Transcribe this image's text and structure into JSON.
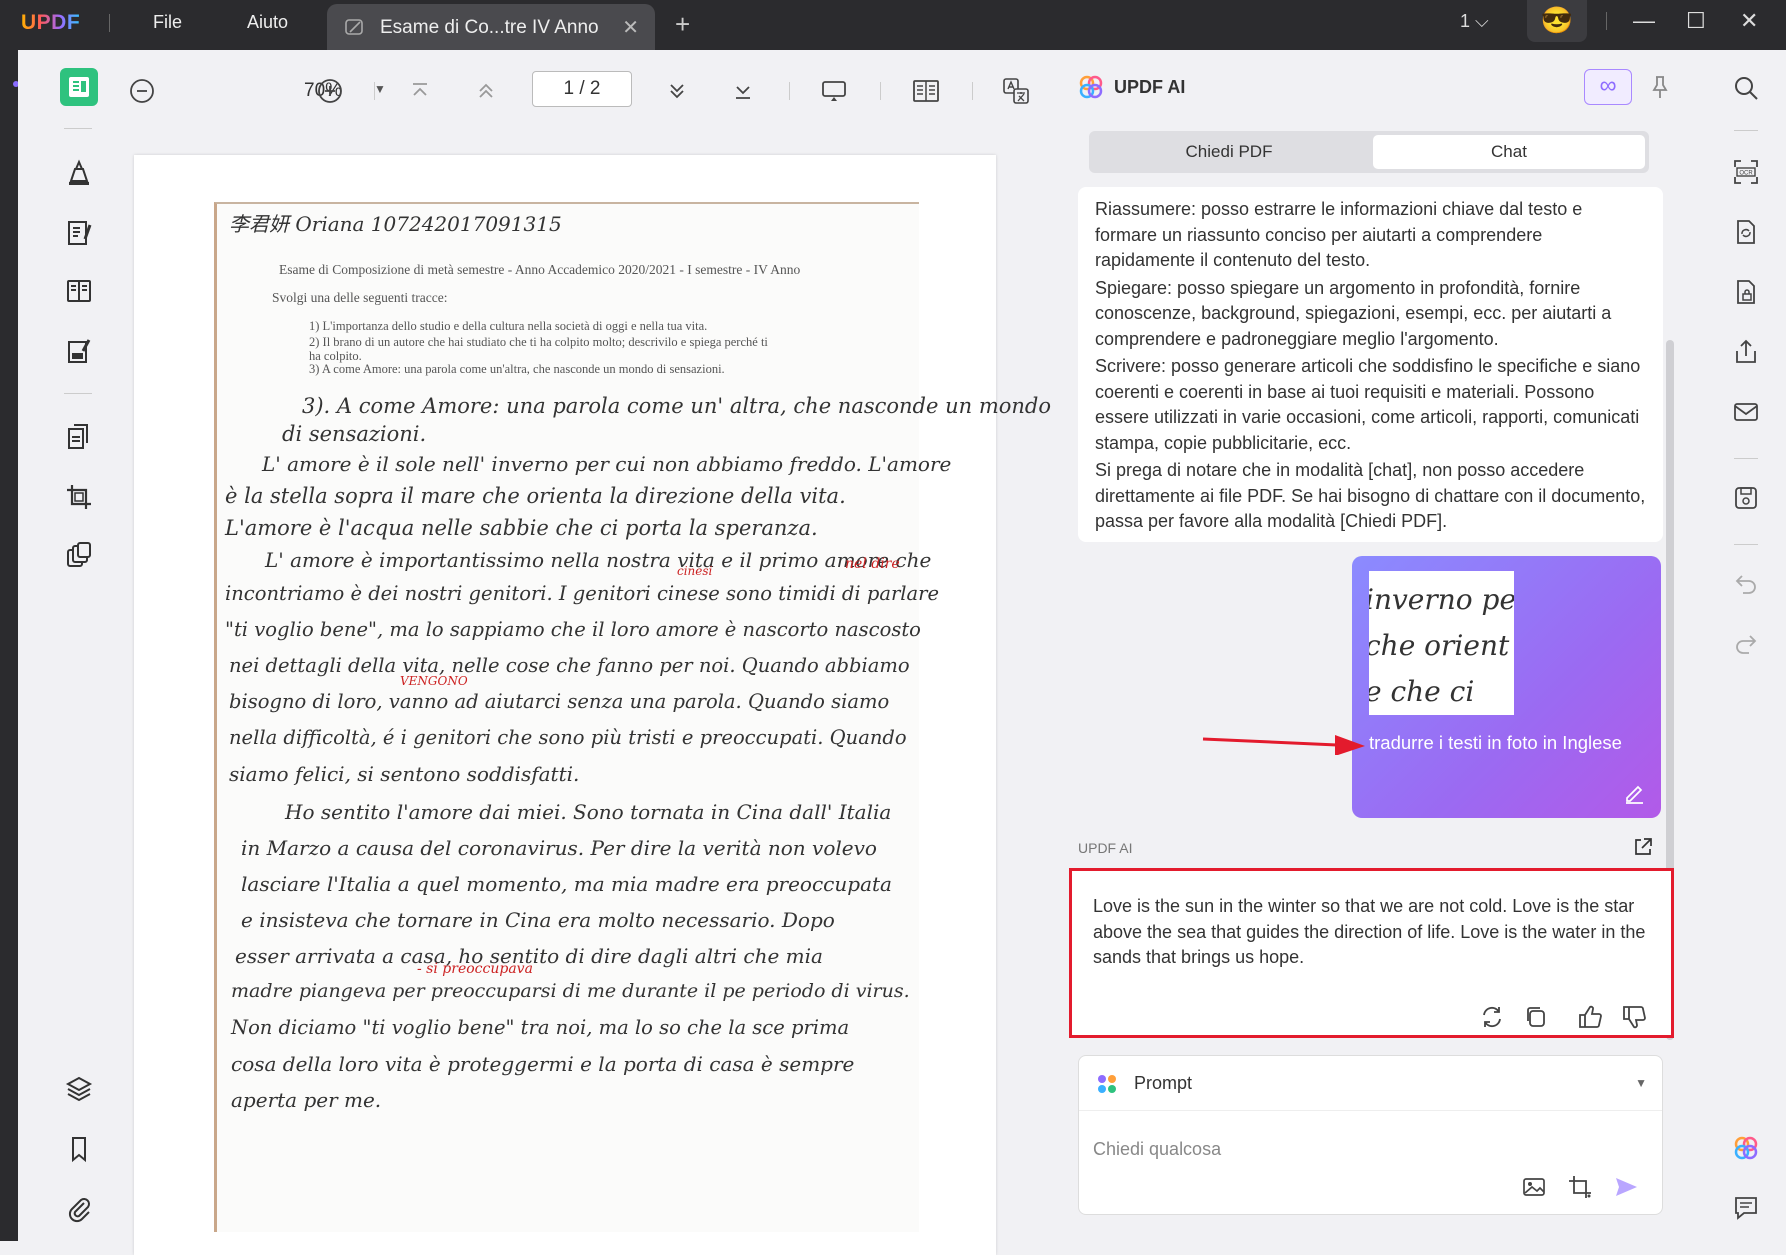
{
  "titlebar": {
    "logo": "UPDF",
    "menu_file": "File",
    "menu_help": "Aiuto",
    "tab_title": "Esame di Co...tre IV Anno",
    "tab_close": "✕",
    "add_tab": "+",
    "page_count": "1 ⌵",
    "avatar": "😎",
    "minimize": "—",
    "maximize": "☐",
    "close": "✕"
  },
  "toolbar": {
    "zoom": "70%",
    "zoom_dropdown": "▼",
    "page": "1 / 2"
  },
  "document": {
    "header_line": "李君妍   Oriana   107242017091315",
    "exam_title": "Esame di Composizione di metà semestre  -  Anno Accademico 2020/2021 - I semestre - IV Anno",
    "instruction": "Svolgi una delle seguenti tracce:",
    "traces": [
      "1)  L'importanza dello studio e della cultura nella società di oggi e nella tua vita.",
      "2)  Il brano di un autore che hai studiato che ti ha colpito molto; descrivilo e spiega perché ti",
      "     ha colpito.",
      "3)  A come Amore: una parola come un'altra, che nasconde un mondo di sensazioni."
    ],
    "handwriting": [
      "3). A come Amore: una parola come un' altra, che nasconde un mondo",
      "di sensazioni.",
      "L' amore è il sole nell' inverno per cui non abbiamo freddo. L'amore",
      "è la stella sopra il mare che orienta la direzione della vita.",
      "L'amore è l'acqua nelle sabbie che ci porta la speranza.",
      "L' amore è importantissimo nella nostra vita e il primo amore che",
      "incontriamo è dei nostri genitori. I genitori cinese sono timidi di parlare",
      "\"ti voglio bene\", ma lo sappiamo che il loro amore è nascorto nascosto",
      "nei dettagli della vita, nelle cose che fanno per noi. Quando abbiamo",
      "bisogno di loro, vanno ad aiutarci senza una parola. Quando siamo",
      "nella difficoltà, é i genitori che sono più tristi e preoccupati. Quando",
      "siamo felici, si sentono soddisfatti.",
      "Ho sentito l'amore dai miei. Sono tornata in Cina dall' Italia",
      "in Marzo a causa del coronavirus. Per dire la verità non volevo",
      "lasciare l'Italia a quel momento, ma mia madre era preoccupata",
      "e insisteva che tornare in Cina era molto necessario. Dopo",
      "esser arrivata a casa, ho sentito di dire dagli altri che mia",
      "madre piangeva per preoccuparsi di me durante il pe periodo di virus.",
      "Non diciamo \"ti voglio bene\" tra noi, ma lo so che la sce prima",
      "cosa della loro vita è proteggermi e la porta di casa è sempre",
      "aperta per me."
    ],
    "corrections": {
      "cinesi": "cinesi",
      "nel_dire": "nel dire",
      "vengono": "VENGONO",
      "si_preoccupava": "- si preoccupava"
    }
  },
  "ai_panel": {
    "title": "UPDF AI",
    "infinity": "∞",
    "tab_pdf": "Chiedi PDF",
    "tab_chat": "Chat",
    "messages": [
      "Riassumere: posso estrarre le informazioni chiave dal testo e formare un riassunto conciso per aiutarti a comprendere rapidamente il contenuto del testo.",
      "Spiegare: posso spiegare un argomento in profondità, fornire conoscenze, background, spiegazioni, esempi, ecc. per aiutarti a comprendere e padroneggiare meglio l'argomento.",
      "Scrivere: posso generare articoli che soddisfino le specifiche e siano coerenti e coerenti in base ai tuoi requisiti e materiali. Possono essere utilizzati in varie occasioni, come articoli, rapporti, comunicati stampa, copie pubblicitarie, ecc.",
      "Si prega di notare che in modalità [chat], non posso accedere direttamente ai file PDF. Se hai bisogno di chattare con il documento, passa per favore alla modalità [Chiedi PDF]."
    ],
    "user_image_lines": [
      "inverno per",
      "che orient",
      "e che ci"
    ],
    "user_message": "tradurre i testi in foto in Inglese",
    "ai_label": "UPDF AI",
    "answer": "Love is the sun in the winter so that we are not cold. Love is the star above the sea that guides the direction of life. Love is the water in the sands that brings us hope.",
    "prompt_label": "Prompt",
    "prompt_dropdown": "▼",
    "input_placeholder": "Chiedi qualcosa"
  },
  "colors": {
    "titlebar": "#2b2b2e",
    "accent": "#8e6cff",
    "active_tool": "#2ec27e",
    "highlight_border": "#e31b2d"
  }
}
